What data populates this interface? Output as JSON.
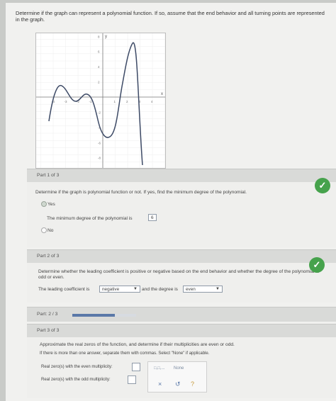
{
  "question": {
    "text": "Determine if the graph can represent a polynomial function. If so, assume that the end behavior and all turning points are represented in the graph."
  },
  "graph": {
    "x_label": "x",
    "y_label": "y",
    "x_ticks": [
      "-4",
      "-3",
      "-2",
      "-1",
      "1",
      "2",
      "3",
      "4"
    ],
    "y_ticks": [
      "8",
      "6",
      "4",
      "2",
      "-2",
      "-4",
      "-6",
      "-8"
    ]
  },
  "part1": {
    "header": "Part 1 of 3",
    "instruction": "Determine if the graph is polynomial function or not. If yes, find the minimum degree of the polynomial.",
    "options": [
      "Yes",
      "No"
    ],
    "selected": "Yes",
    "min_degree_label": "The minimum degree of the polynomial is",
    "min_degree_value": "6",
    "status_icon": "check"
  },
  "part2": {
    "header": "Part 2 of 3",
    "instruction": "Determine whether the leading coefficient is positive or negative based on the end behavior and whether the degree of the polynomial is odd or even.",
    "leading_label": "The leading coefficient is",
    "leading_value": "negative",
    "degree_label": "and the degree is",
    "degree_value": "even",
    "status_icon": "check"
  },
  "progress": {
    "label": "Part: 2 / 3",
    "fraction": 0.67
  },
  "part3": {
    "header": "Part 3 of 3",
    "instruction": "Approximate the real zeros of the function, and determine if their multiplicities are even or odd.",
    "note": "If there is more than one answer, separate them with commas. Select \"None\" if applicable.",
    "even_label": "Real zero(s) with the even multiplicity:",
    "odd_label": "Real zero(s) with the odd multiplicity:",
    "palette_none": "None",
    "palette_comma": "□,□,...",
    "palette_clear": "×",
    "palette_undo": "↺",
    "palette_help": "?"
  }
}
